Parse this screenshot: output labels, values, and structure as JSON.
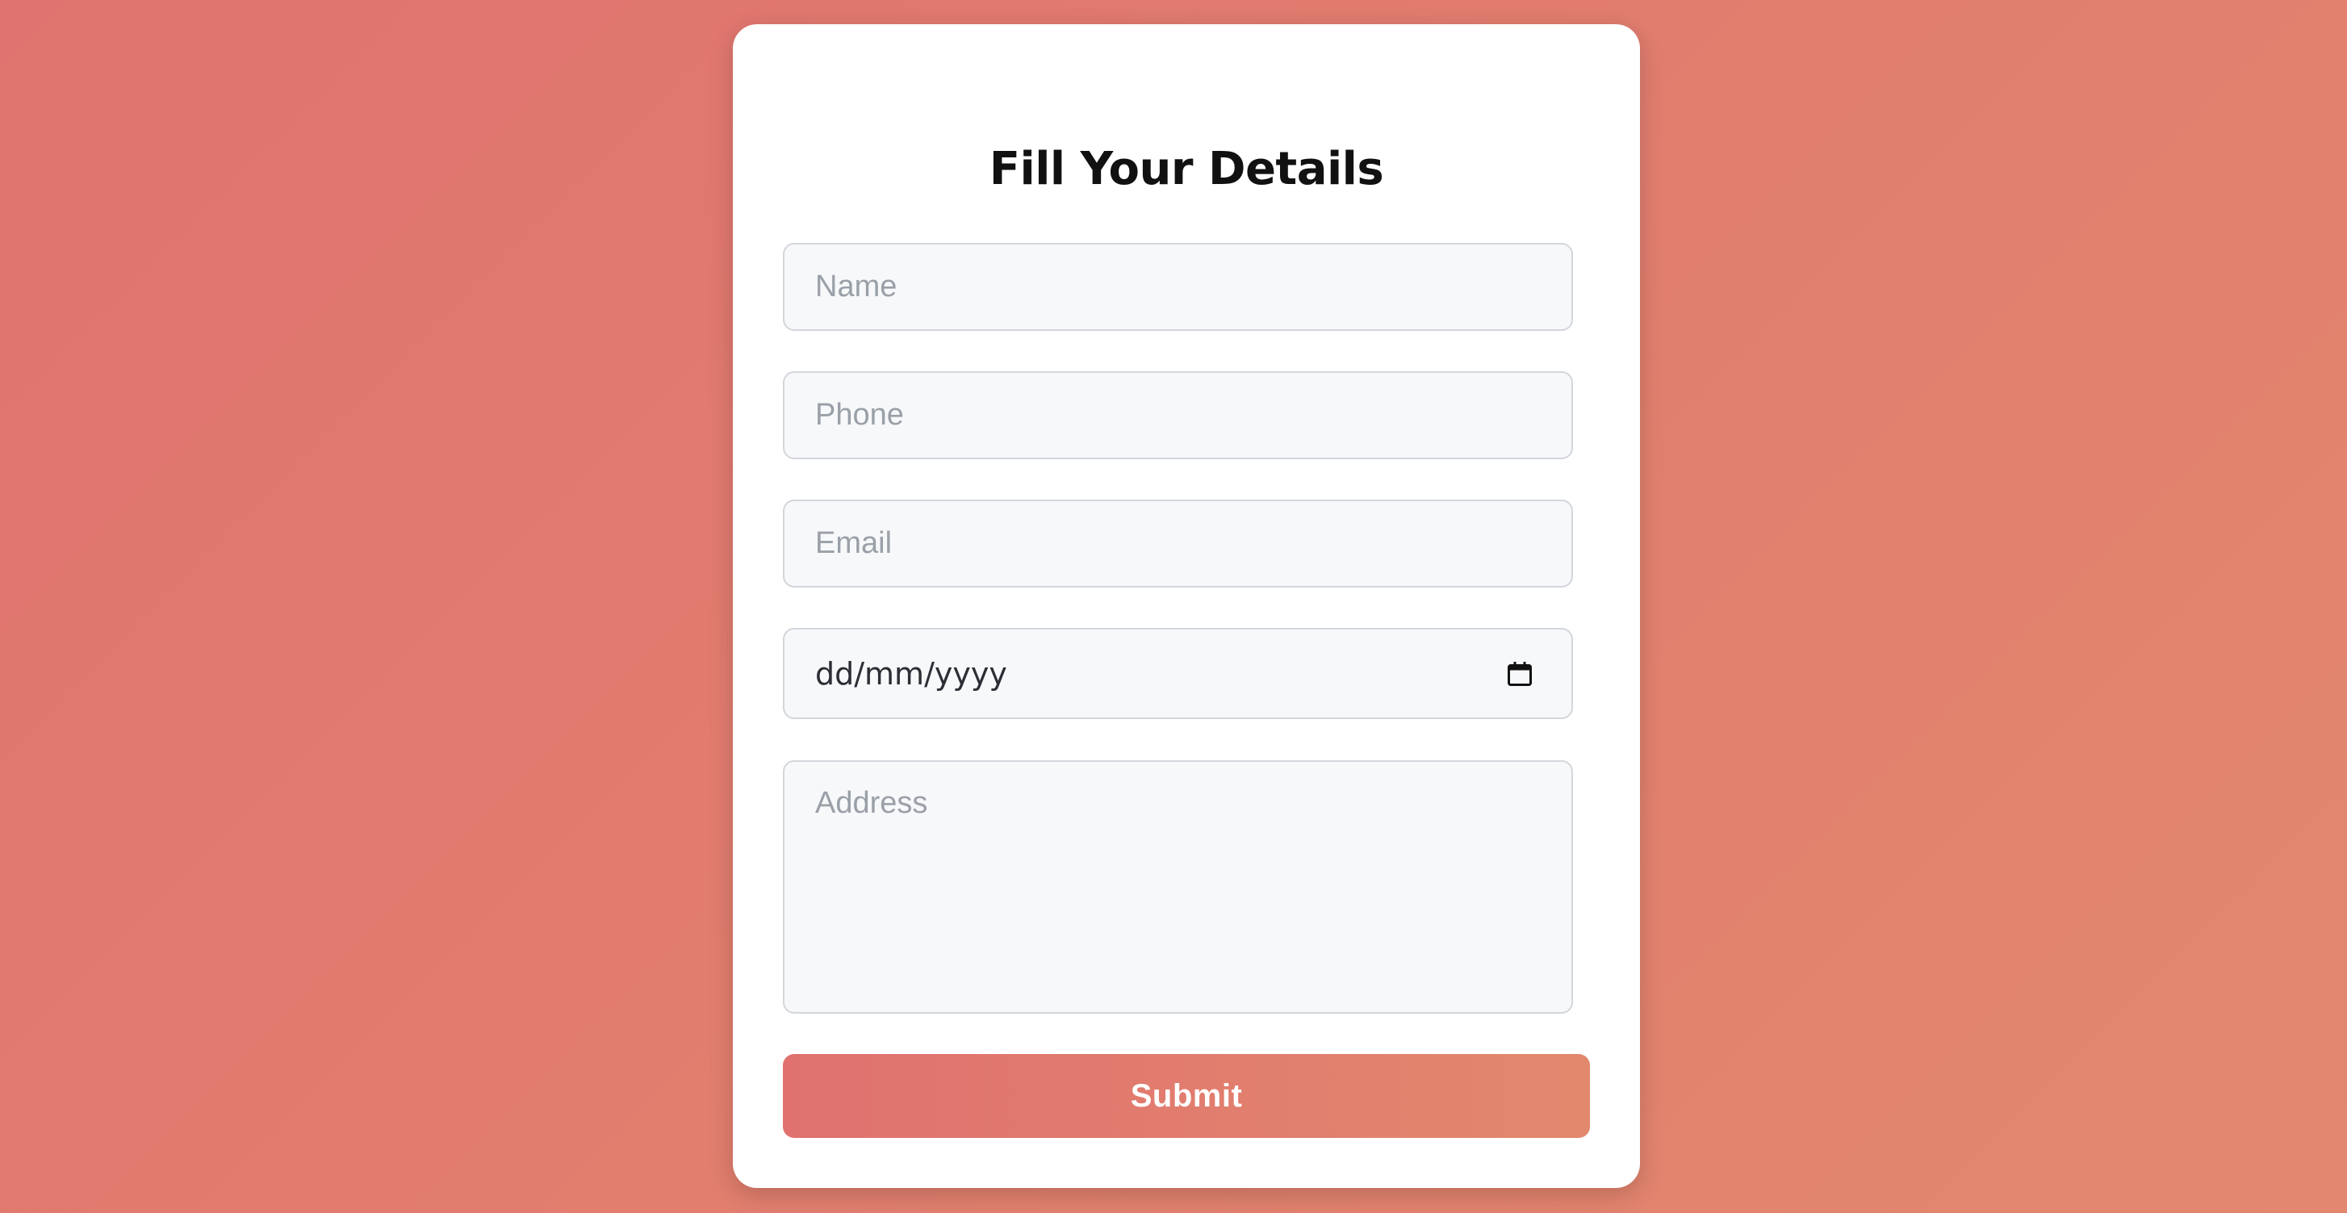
{
  "form": {
    "title": "Fill Your Details",
    "name_placeholder": "Name",
    "phone_placeholder": "Phone",
    "email_placeholder": "Email",
    "date_placeholder": "dd/mm/yyyy",
    "date_icon": "calendar-icon",
    "address_placeholder": "Address",
    "submit_label": "Submit"
  },
  "colors": {
    "background_start": "#e0736f",
    "background_end": "#e2886e",
    "card": "#ffffff",
    "field_background": "#f7f8fa",
    "field_border": "#d3d6db",
    "placeholder": "#9aa0a8",
    "submit_text": "#ffffff"
  }
}
